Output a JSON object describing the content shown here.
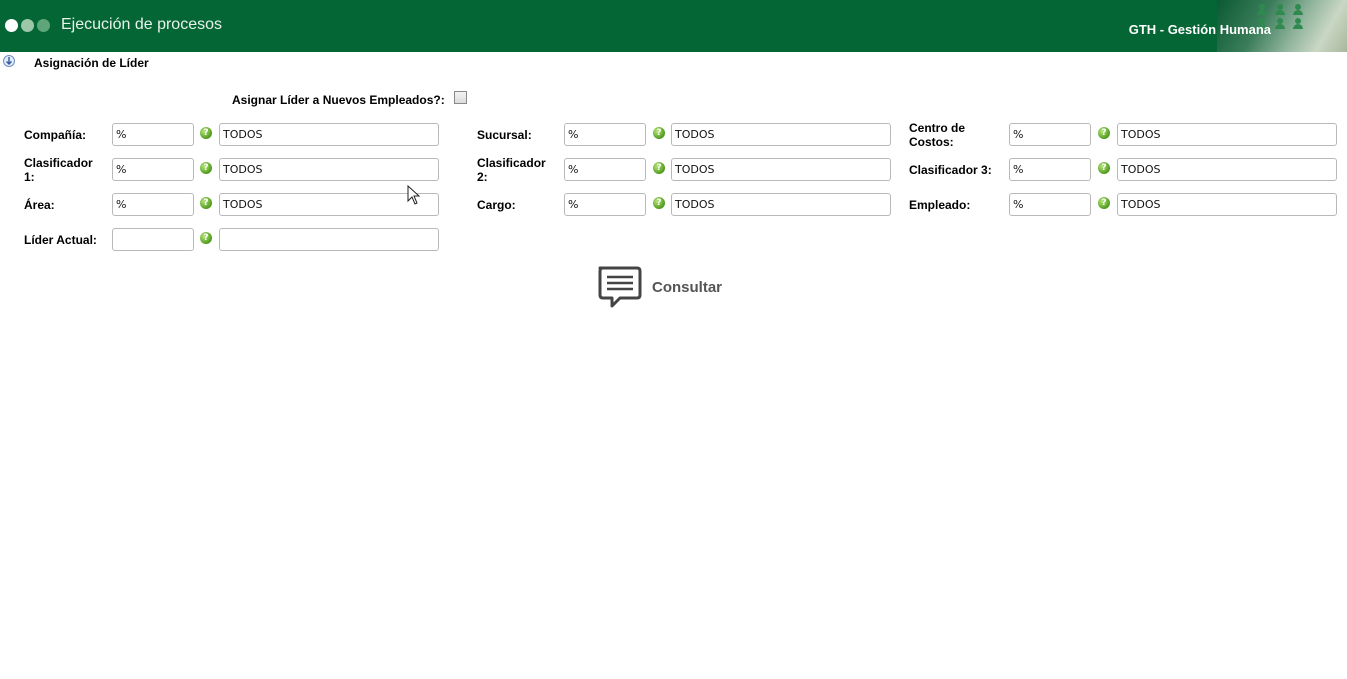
{
  "header": {
    "title": "Ejecución de procesos",
    "module": "GTH - Gestión Humana",
    "color": "#036634"
  },
  "page": {
    "title": "Asignación de Líder"
  },
  "form": {
    "checkbox_label": "Asignar Líder a Nuevos Empleados?:",
    "checkbox_checked": false,
    "help_glyph": "?",
    "fields": {
      "compania": {
        "label": "Compañía:",
        "code": "%",
        "desc": "TODOS"
      },
      "sucursal": {
        "label": "Sucursal:",
        "code": "%",
        "desc": "TODOS"
      },
      "centro_costos": {
        "label": "Centro de Costos:",
        "code": "%",
        "desc": "TODOS"
      },
      "clasificador1": {
        "label": "Clasificador 1:",
        "code": "%",
        "desc": "TODOS"
      },
      "clasificador2": {
        "label": "Clasificador 2:",
        "code": "%",
        "desc": "TODOS"
      },
      "clasificador3": {
        "label": "Clasificador 3:",
        "code": "%",
        "desc": "TODOS"
      },
      "area": {
        "label": "Área:",
        "code": "%",
        "desc": "TODOS"
      },
      "cargo": {
        "label": "Cargo:",
        "code": "%",
        "desc": "TODOS"
      },
      "empleado": {
        "label": "Empleado:",
        "code": "%",
        "desc": "TODOS"
      },
      "lider_actual": {
        "label": "Líder Actual:",
        "code": "",
        "desc": ""
      }
    }
  },
  "actions": {
    "consultar_label": "Consultar",
    "consultar_icon": "chat-icon"
  }
}
